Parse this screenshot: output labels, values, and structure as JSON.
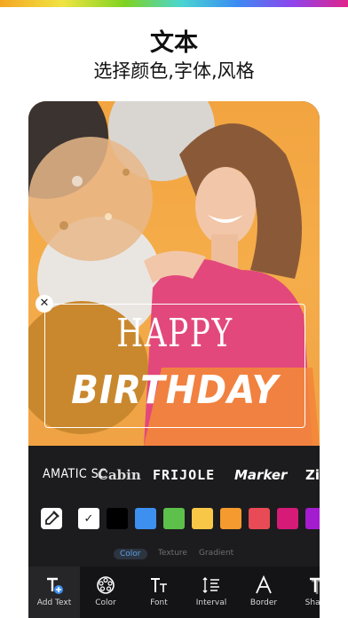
{
  "header": {
    "title": "文本",
    "subtitle": "选择颜色,字体,风格"
  },
  "canvas": {
    "text_line1": "HAPPY",
    "text_line2": "BIRTHDAY",
    "close_glyph": "✕"
  },
  "fonts": {
    "items": [
      "AMATIC SC",
      "Cabin",
      "FRIJOLE",
      "Marker",
      "Zi"
    ]
  },
  "colors": {
    "picker_icon": "eyedropper-icon",
    "swatches": [
      "#ffffff",
      "#000000",
      "#3d8ff0",
      "#5cc04a",
      "#f9c748",
      "#f59a2e",
      "#e84b55",
      "#d61a78",
      "#a41ccf"
    ],
    "selected_index": 0
  },
  "style_tabs": {
    "items": [
      "Color",
      "Texture",
      "Gradient"
    ],
    "active": "Color"
  },
  "toolbar": {
    "items": [
      "Add Text",
      "Color",
      "Font",
      "Interval",
      "Border",
      "Shad"
    ],
    "active": "Add Text"
  }
}
